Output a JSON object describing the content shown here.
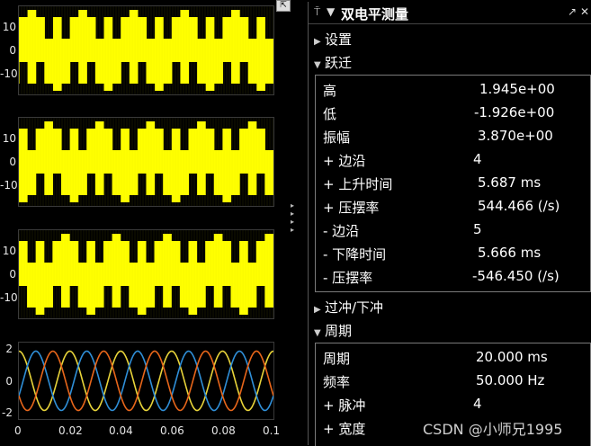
{
  "scopes": [
    {
      "yticks": [
        "10",
        "0",
        "-10"
      ],
      "kind": "square"
    },
    {
      "yticks": [
        "10",
        "0",
        "-10"
      ],
      "kind": "square"
    },
    {
      "yticks": [
        "10",
        "0",
        "-10"
      ],
      "kind": "square"
    },
    {
      "yticks": [
        "2",
        "0",
        "-2"
      ],
      "kind": "sine"
    }
  ],
  "xaxis": [
    "0",
    "0.02",
    "0.04",
    "0.06",
    "0.08",
    "0.1"
  ],
  "colors": {
    "trace_yellow": "#ffff00",
    "sine_blue": "#2f8fd8",
    "sine_orange": "#e8661a",
    "sine_yellow": "#e8d43a"
  },
  "panel": {
    "title": "双电平测量",
    "sections": {
      "settings": "设置",
      "transitions": "跃迁",
      "overshoot": "过冲/下冲",
      "cycles": "周期"
    },
    "transition_rows": [
      {
        "label": "高",
        "value": "1.945e+00"
      },
      {
        "label": "低",
        "value": "-1.926e+00"
      },
      {
        "label": "振幅",
        "value": "3.870e+00"
      },
      {
        "label": "+ 边沿",
        "value": "4"
      },
      {
        "label": "+ 上升时间",
        "value": "5.687 ms"
      },
      {
        "label": "+ 压摆率",
        "value": "544.466 (/s)"
      },
      {
        "label": "- 边沿",
        "value": "5"
      },
      {
        "label": "- 下降时间",
        "value": "5.666 ms"
      },
      {
        "label": "- 压摆率",
        "value": "-546.450 (/s)"
      }
    ],
    "cycle_rows": [
      {
        "label": "周期",
        "value": "20.000 ms"
      },
      {
        "label": "频率",
        "value": "50.000 Hz"
      },
      {
        "label": "+ 脉冲",
        "value": "4"
      },
      {
        "label": "+ 宽度",
        "value": ""
      }
    ]
  },
  "watermark": "CSDN @小师兄1995"
}
